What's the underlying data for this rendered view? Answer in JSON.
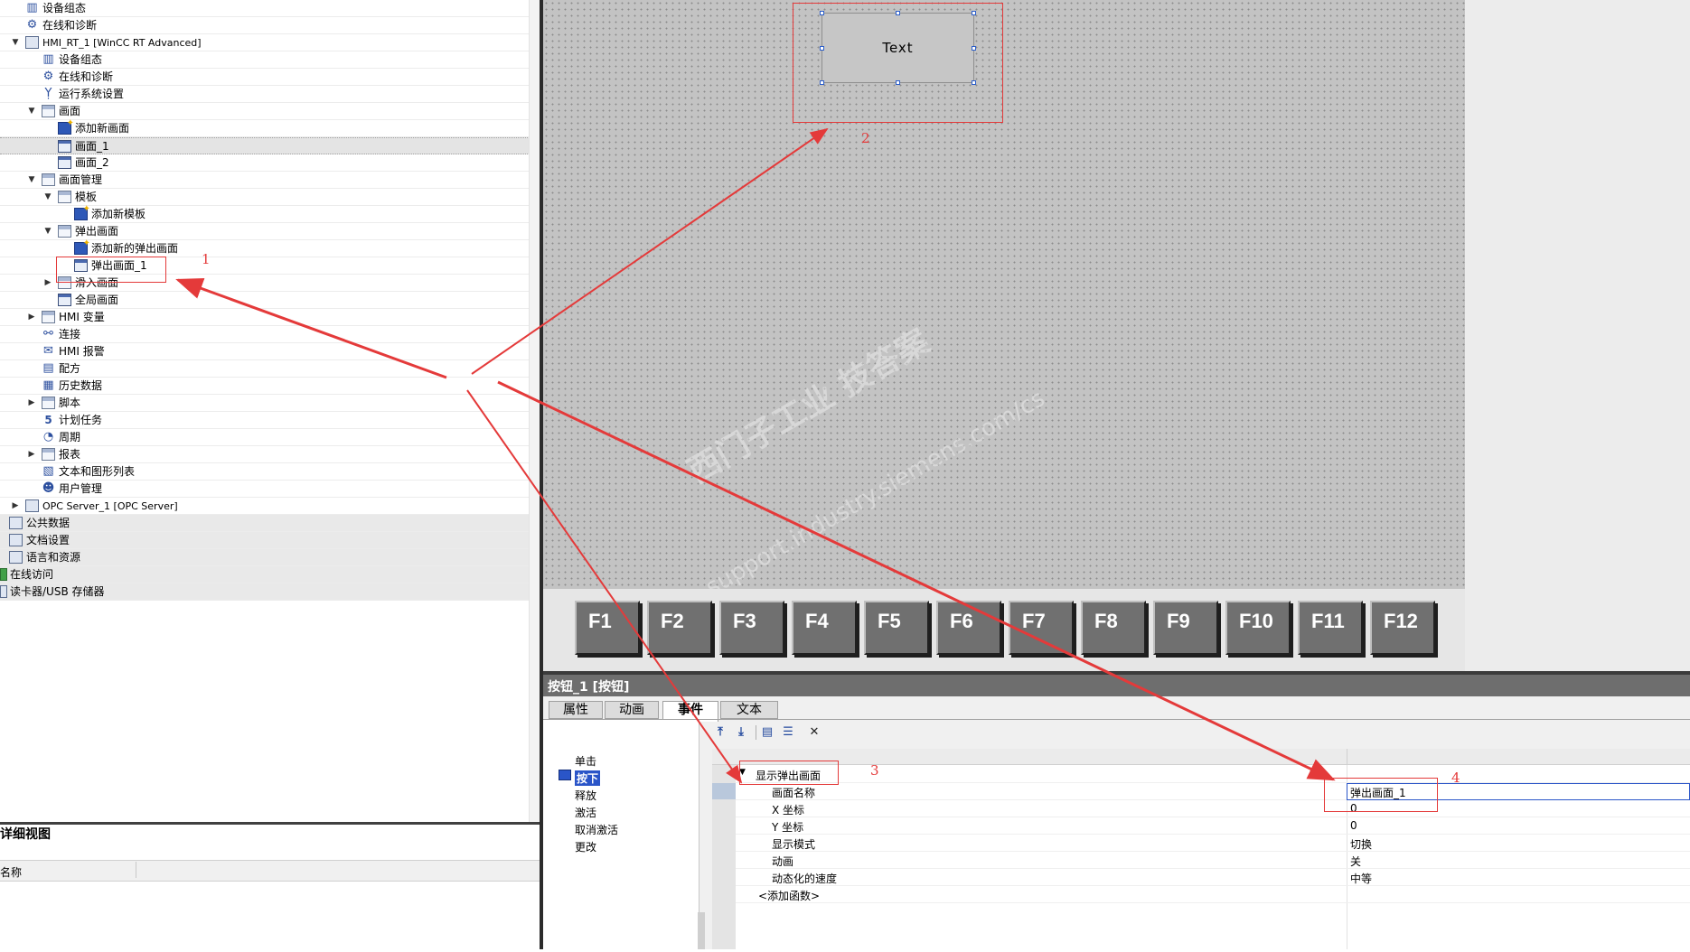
{
  "tree": {
    "items": [
      {
        "label": "设备组态",
        "icon": "device-config-icon"
      },
      {
        "label": "在线和诊断",
        "icon": "diagnostics-icon"
      },
      {
        "label": "HMI_RT_1 [WinCC RT Advanced]",
        "icon": "hmi-device-icon"
      },
      {
        "label": "设备组态",
        "icon": "device-config-icon"
      },
      {
        "label": "在线和诊断",
        "icon": "diagnostics-icon"
      },
      {
        "label": "运行系统设置",
        "icon": "runtime-settings-icon"
      },
      {
        "label": "画面",
        "icon": "screens-folder-icon"
      },
      {
        "label": "添加新画面",
        "icon": "add-screen-icon"
      },
      {
        "label": "画面_1",
        "icon": "screen-icon"
      },
      {
        "label": "画面_2",
        "icon": "screen-icon"
      },
      {
        "label": "画面管理",
        "icon": "screen-management-icon"
      },
      {
        "label": "模板",
        "icon": "template-folder-icon"
      },
      {
        "label": "添加新模板",
        "icon": "add-template-icon"
      },
      {
        "label": "弹出画面",
        "icon": "popup-folder-icon"
      },
      {
        "label": "添加新的弹出画面",
        "icon": "add-popup-icon"
      },
      {
        "label": "弹出画面_1",
        "icon": "popup-screen-icon"
      },
      {
        "label": "滑入画面",
        "icon": "slidein-folder-icon"
      },
      {
        "label": "全局画面",
        "icon": "global-screen-icon"
      },
      {
        "label": "HMI 变量",
        "icon": "hmi-tags-icon"
      },
      {
        "label": "连接",
        "icon": "connections-icon"
      },
      {
        "label": "HMI 报警",
        "icon": "alarms-icon"
      },
      {
        "label": "配方",
        "icon": "recipes-icon"
      },
      {
        "label": "历史数据",
        "icon": "historical-data-icon"
      },
      {
        "label": "脚本",
        "icon": "scripts-icon"
      },
      {
        "label": "计划任务",
        "icon": "scheduled-tasks-icon"
      },
      {
        "label": "周期",
        "icon": "cycles-icon"
      },
      {
        "label": "报表",
        "icon": "reports-icon"
      },
      {
        "label": "文本和图形列表",
        "icon": "text-graphic-lists-icon"
      },
      {
        "label": "用户管理",
        "icon": "user-admin-icon"
      },
      {
        "label": "OPC Server_1 [OPC Server]",
        "icon": "opc-server-icon"
      },
      {
        "label": "公共数据",
        "icon": "common-data-icon"
      },
      {
        "label": "文档设置",
        "icon": "doc-settings-icon"
      },
      {
        "label": "语言和资源",
        "icon": "languages-icon"
      },
      {
        "label": "在线访问",
        "icon": "online-access-icon"
      },
      {
        "label": "读卡器/USB 存储器",
        "icon": "card-reader-icon"
      }
    ]
  },
  "detail_view": {
    "title": "详细视图",
    "column_name": "名称"
  },
  "canvas": {
    "button_text": "Text",
    "function_keys": [
      "F1",
      "F2",
      "F3",
      "F4",
      "F5",
      "F6",
      "F7",
      "F8",
      "F9",
      "F10",
      "F11",
      "F12"
    ],
    "watermark_line1": "西门子工业 技答案",
    "watermark_line2": "support.industry.siemens.com/cs"
  },
  "properties": {
    "title": "按钮_1 [按钮]",
    "tabs": [
      "属性",
      "动画",
      "事件",
      "文本"
    ],
    "active_tab": "事件",
    "events": [
      "单击",
      "按下",
      "释放",
      "激活",
      "取消激活",
      "更改"
    ],
    "selected_event": "按下",
    "function_name": "显示弹出画面",
    "params": [
      {
        "name": "画面名称",
        "value": "弹出画面_1"
      },
      {
        "name": "X 坐标",
        "value": "0"
      },
      {
        "name": "Y 坐标",
        "value": "0"
      },
      {
        "name": "显示模式",
        "value": "切换"
      },
      {
        "name": "动画",
        "value": "关"
      },
      {
        "name": "动态化的速度",
        "value": "中等"
      }
    ],
    "add_function": "<添加函数>"
  },
  "annotations": {
    "labels": [
      "1",
      "2",
      "3",
      "4"
    ],
    "color": "#e43a3a"
  }
}
